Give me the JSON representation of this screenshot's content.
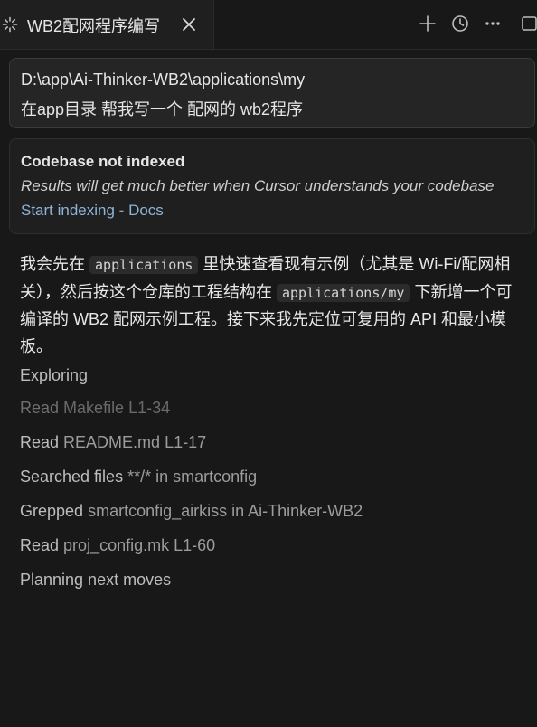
{
  "tab": {
    "title": "WB2配网程序编写",
    "spinner_icon": "spinner-icon",
    "close_icon": "close-icon"
  },
  "toolbar": {
    "icons": [
      "plus-icon",
      "history-icon",
      "more-icon",
      "panel-icon"
    ]
  },
  "prompt": {
    "path": "D:\\app\\Ai-Thinker-WB2\\applications\\my",
    "text": "在app目录 帮我写一个 配网的 wb2程序"
  },
  "notice": {
    "title": "Codebase not indexed",
    "description": "Results will get much better when Cursor understands your codebase",
    "link_start": "Start indexing",
    "separator": " - ",
    "link_docs": "Docs"
  },
  "message": {
    "p1": "我会先在 ",
    "code1": "applications",
    "p2": " 里快速查看现有示例（尤其是 Wi-Fi/配网相关），然后按这个仓库的工程结构在 ",
    "code2": "applications/my",
    "p3": " 下新增一个可编译的 WB2 配网示例工程。接下来我先定位可复用的 API 和最小模板。"
  },
  "steps": [
    {
      "verb": "Exploring",
      "arg": ""
    },
    {
      "verb": "Read",
      "arg": "Makefile L1-34"
    },
    {
      "verb": "Read",
      "arg": "README.md L1-17"
    },
    {
      "verb": "Searched files",
      "arg": "**/* in smartconfig"
    },
    {
      "verb": "Grepped",
      "arg": "smartconfig_airkiss in Ai-Thinker-WB2"
    },
    {
      "verb": "Read",
      "arg": "proj_config.mk L1-60"
    },
    {
      "verb": "Planning next moves",
      "arg": ""
    }
  ]
}
